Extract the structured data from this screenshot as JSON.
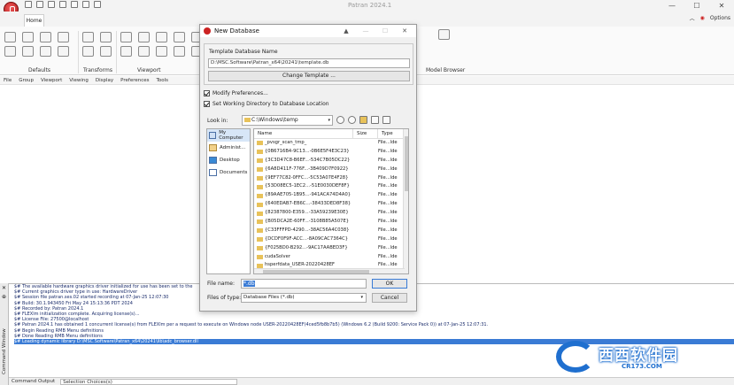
{
  "window": {
    "title": "Patran 2024.1",
    "controls": [
      "—",
      "☐",
      "✕"
    ]
  },
  "ribbon": {
    "tab_home": "Home",
    "options": "Options",
    "groups": [
      "Defaults",
      "Transforms",
      "Viewport",
      "Model Browser"
    ]
  },
  "menubar": [
    "File",
    "Group",
    "Viewport",
    "Viewing",
    "Display",
    "Preferences",
    "Tools"
  ],
  "dialog": {
    "title": "New Database",
    "template_label": "Template Database Name",
    "template_value": "D:\\MSC.Software\\Patran_x64\\20241\\template.db",
    "change_template": "Change Template ...",
    "modify_prefs": "Modify Preferences...",
    "set_working_dir": "Set Working Directory to Database Location",
    "look_in_label": "Look in:",
    "look_in_value": "C:\\Windows\\temp",
    "places": [
      "My Computer",
      "Administ...",
      "Desktop",
      "Documents"
    ],
    "columns": [
      "Name",
      "Size",
      "Type"
    ],
    "files": [
      {
        "name": "_pvsgr_scan_tmp_",
        "size": "",
        "type": "File...lde"
      },
      {
        "name": "{0B6716B4-9C13...-0B6E5F4E3C23}",
        "size": "",
        "type": "File...lde"
      },
      {
        "name": "{3C3D47C8-B6EF...-534C7B05DC22}",
        "size": "",
        "type": "File...lde"
      },
      {
        "name": "{6A8D411F-776F...-3B409D7F0922}",
        "size": "",
        "type": "File...lde"
      },
      {
        "name": "{9EF77C82-0FFC...-5C53A07E4F28}",
        "size": "",
        "type": "File...lde"
      },
      {
        "name": "{53D08EC5-1EC2...-51E0030DEF8F}",
        "size": "",
        "type": "File...lde"
      },
      {
        "name": "{89AAE705-1B95...-941ACA74D4A0}",
        "size": "",
        "type": "File...lde"
      },
      {
        "name": "{640EDAB7-EB6C...-38433DED8F38}",
        "size": "",
        "type": "File...lde"
      },
      {
        "name": "{82387800-E359...-33A59239E30E}",
        "size": "",
        "type": "File...lde"
      },
      {
        "name": "{B05DCA2E-60FF...-3108B85A507E}",
        "size": "",
        "type": "File...lde"
      },
      {
        "name": "{C33FFFPD-4290...-38AC56A4C038}",
        "size": "",
        "type": "File...lde"
      },
      {
        "name": "{DCDF0F9F-ACC...-8A09CAC7364C}",
        "size": "",
        "type": "File...lde"
      },
      {
        "name": "{F025BD0-B292...-9AC17AABED3F}",
        "size": "",
        "type": "File...lde"
      },
      {
        "name": "cudaSolver",
        "size": "",
        "type": "File...lde"
      },
      {
        "name": "hsperfdata_USER-20220428EF",
        "size": "",
        "type": "File...lde"
      }
    ],
    "file_name_label": "File name:",
    "file_name_value": "*.db",
    "file_type_label": "Files of type:",
    "file_type_value": "Database Files (*.db)",
    "ok": "OK",
    "cancel": "Cancel"
  },
  "console": {
    "lines": [
      "$# The available hardware graphics driver initialized for use has been set to the",
      "$# Current graphics driver type in use: HardwareDriver",
      "$# Session file patran.ses.02 started recording at 07-Jan-25 12:07:30",
      "$# Build: 30.1.943450 Fri May 24 15:13:36 PDT 2024",
      "$# Recorded by: Patran 2024.1",
      "$# FLEXlm initialization complete.  Acquiring license(s)...",
      "$# License File: 27500@localhost",
      "$# Patran 2024.1 has obtained 1 concurrent license(s) from FLEXlm per a request to execute on Windows node USER-20220428EF(4ced5fb8b7b5) (Windows 6.2 (Build 9200: Service Pack 0)) at 07-Jan-25 12:07:31.",
      "$# Begin Reading RMB Menu definitions",
      "$# Done Reading RMB Menu definitions",
      "$# Loading dynamic library D:\\MSC.Software\\Patran_x64\\20241\\lib\\adc_browser.dll"
    ],
    "side_title": "Command Window"
  },
  "cmdline": {
    "label": "Command Output",
    "value": "Selection Choices(s)"
  },
  "watermark": {
    "text": "西西软件园",
    "sub": "CR173.COM"
  }
}
